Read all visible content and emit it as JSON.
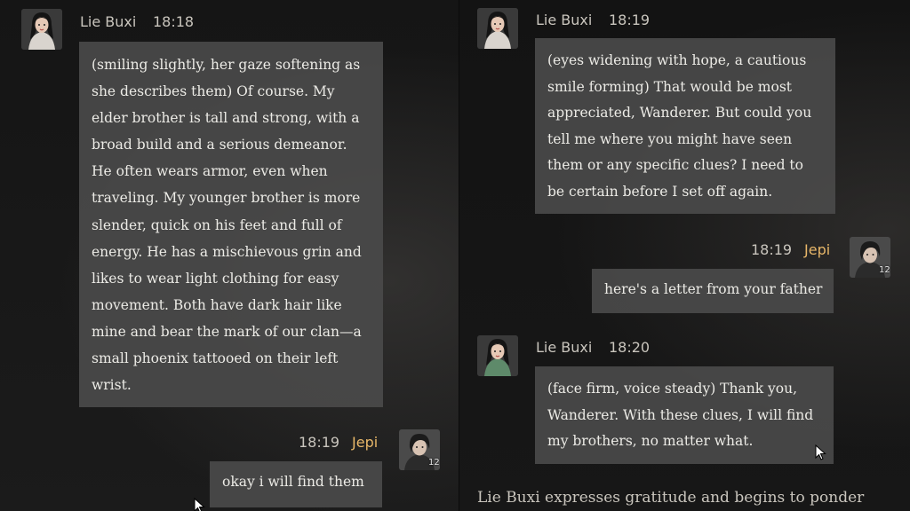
{
  "left_pane": {
    "npc_message": {
      "name": "Lie Buxi",
      "time": "18:18",
      "text": "(smiling slightly, her gaze softening as she describes them) Of course. My elder brother is tall and strong, with a broad build and a serious demeanor. He often wears armor, even when traveling. My younger brother is more slender, quick on his feet and full of energy. He has a mischievous grin and likes to wear light clothing for easy movement. Both have dark hair like mine and bear the mark of our clan—a small phoenix tattooed on their left wrist."
    },
    "player_message": {
      "name": "Jepi",
      "time": "18:19",
      "level": "12",
      "text": "okay i will find them"
    }
  },
  "right_pane": {
    "npc_message_1": {
      "name": "Lie Buxi",
      "time": "18:19",
      "text": "(eyes widening with hope, a cautious smile forming) That would be most appreciated, Wanderer. But could you tell me where you might have seen them or any specific clues? I need to be certain before I set off again."
    },
    "player_message": {
      "name": "Jepi",
      "time": "18:19",
      "level": "12",
      "text": "here's a letter from your father"
    },
    "npc_message_2": {
      "name": "Lie Buxi",
      "time": "18:20",
      "text": "(face firm, voice steady) Thank you, Wanderer. With these clues, I will find my brothers, no matter what."
    },
    "narration": "Lie Buxi expresses gratitude and begins to ponder"
  },
  "colors": {
    "bubble": "#4a4a4a",
    "player_name": "#e8b769",
    "text": "#ecebe6",
    "meta": "#c9c5bd"
  },
  "icons": [
    "female-avatar-icon",
    "male-avatar-icon",
    "mouse-cursor-icon"
  ]
}
